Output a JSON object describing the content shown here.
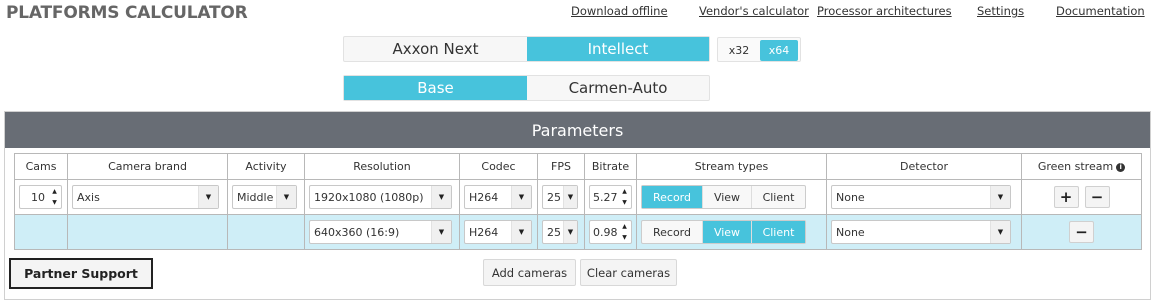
{
  "app": {
    "title": "PLATFORMS CALCULATOR"
  },
  "top_links": [
    "Download offline",
    "Vendor's calculator",
    "Processor architectures",
    "Settings",
    "Documentation"
  ],
  "product_toggle": {
    "options": [
      "Axxon Next",
      "Intellect"
    ],
    "selected": "Intellect"
  },
  "arch_toggle": {
    "options": [
      "x32",
      "x64"
    ],
    "selected": "x64"
  },
  "module_toggle": {
    "options": [
      "Base",
      "Carmen-Auto"
    ],
    "selected": "Base"
  },
  "parameters": {
    "title": "Parameters",
    "columns": [
      "Cams",
      "Camera brand",
      "Activity",
      "Resolution",
      "Codec",
      "FPS",
      "Bitrate",
      "Stream types",
      "Detector",
      "Green stream"
    ],
    "rows": [
      {
        "cams": "10",
        "camera_brand": "Axis",
        "activity": "Middle",
        "resolution": "1920x1080 (1080p)",
        "codec": "H264",
        "fps": "25",
        "bitrate": "5.27",
        "stream_types": [
          {
            "label": "Record",
            "active": true
          },
          {
            "label": "View",
            "active": false
          },
          {
            "label": "Client",
            "active": false
          }
        ],
        "detector": "None",
        "green_stream_buttons": [
          "+",
          "−"
        ]
      },
      {
        "resolution": "640x360 (16:9)",
        "codec": "H264",
        "fps": "25",
        "bitrate": "0.98",
        "stream_types": [
          {
            "label": "Record",
            "active": false
          },
          {
            "label": "View",
            "active": true
          },
          {
            "label": "Client",
            "active": true
          }
        ],
        "detector": "None",
        "green_stream_buttons": [
          "−"
        ]
      }
    ]
  },
  "buttons": {
    "partner_support": "Partner Support",
    "add_cameras": "Add cameras",
    "clear_cameras": "Clear cameras"
  },
  "colors": {
    "accent": "#47c3dc",
    "header_bg": "#686d75",
    "substream_row_bg": "#cfeef7"
  }
}
